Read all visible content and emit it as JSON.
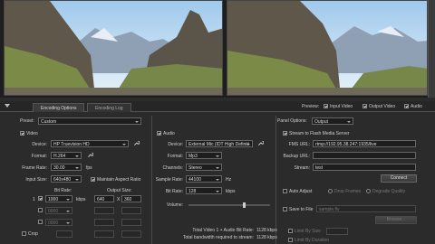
{
  "tabs": {
    "encoding": "Encoding Options",
    "log": "Encoding Log"
  },
  "preview_bar": {
    "label": "Preview:",
    "input": "Input Video",
    "output": "Output Video",
    "audio": "Audio"
  },
  "preset": {
    "label": "Preset:",
    "value": "Custom"
  },
  "panel_options": {
    "label": "Panel Options:",
    "value": "Output"
  },
  "video": {
    "section": "Video",
    "device_label": "Device:",
    "device": "HP Truevision HD",
    "format_label": "Format:",
    "format": "H.264",
    "frame_rate_label": "Frame Rate:",
    "frame_rate": "30.00",
    "fps": "fps",
    "input_size_label": "Input Size:",
    "input_size": "640x480",
    "maintain_aspect": "Maintain Aspect Ratio",
    "bit_rate_label": "Bit Rate:",
    "output_size_label": "Output Size:",
    "row_num": "1",
    "bit_rate": "1000",
    "kbps": "kbps",
    "out_w": "640",
    "out_x": "X",
    "out_h": "360",
    "row2_bit": "0000",
    "row3_bit": "0000",
    "crop": "Crop"
  },
  "audio": {
    "section": "Audio",
    "device_label": "Device:",
    "device": "External Mic (IDT High Definiti",
    "format_label": "Format:",
    "format": "Mp3",
    "channels_label": "Channels:",
    "channels": "Stereo",
    "sample_rate_label": "Sample Rate:",
    "sample_rate": "44100",
    "hz": "Hz",
    "bit_rate_label": "Bit Rate:",
    "bit_rate": "128",
    "kbps": "kbps",
    "volume_label": "Volume:",
    "total_label": "Total Video 1 + Audio Bit Rate:",
    "total_value": "1128 kbps",
    "bandwidth_label": "Total bandwidth required to stream:",
    "bandwidth_value": "1128 kbps"
  },
  "stream": {
    "section": "Stream to Flash Media Server",
    "fms_label": "FMS URL:",
    "fms_url": "rtmp://192.95.38.247:1935/live",
    "backup_label": "Backup URL:",
    "backup_url": "",
    "stream_label": "Stream:",
    "stream_name": "test",
    "connect": "Connect",
    "auto_adjust": "Auto Adjust",
    "drop_frames": "Drop Frames",
    "degrade_quality": "Degrade Quality",
    "save_to_file": "Save to File",
    "file_name": "sample.flv",
    "browse": "Browse...",
    "limit_by_size": "Limit By Size",
    "limit_by_duration": "Limit By Duration"
  },
  "colors": {
    "bg": "#2b2b2b",
    "panel": "#1d1d1d",
    "text": "#d8d8d8"
  }
}
